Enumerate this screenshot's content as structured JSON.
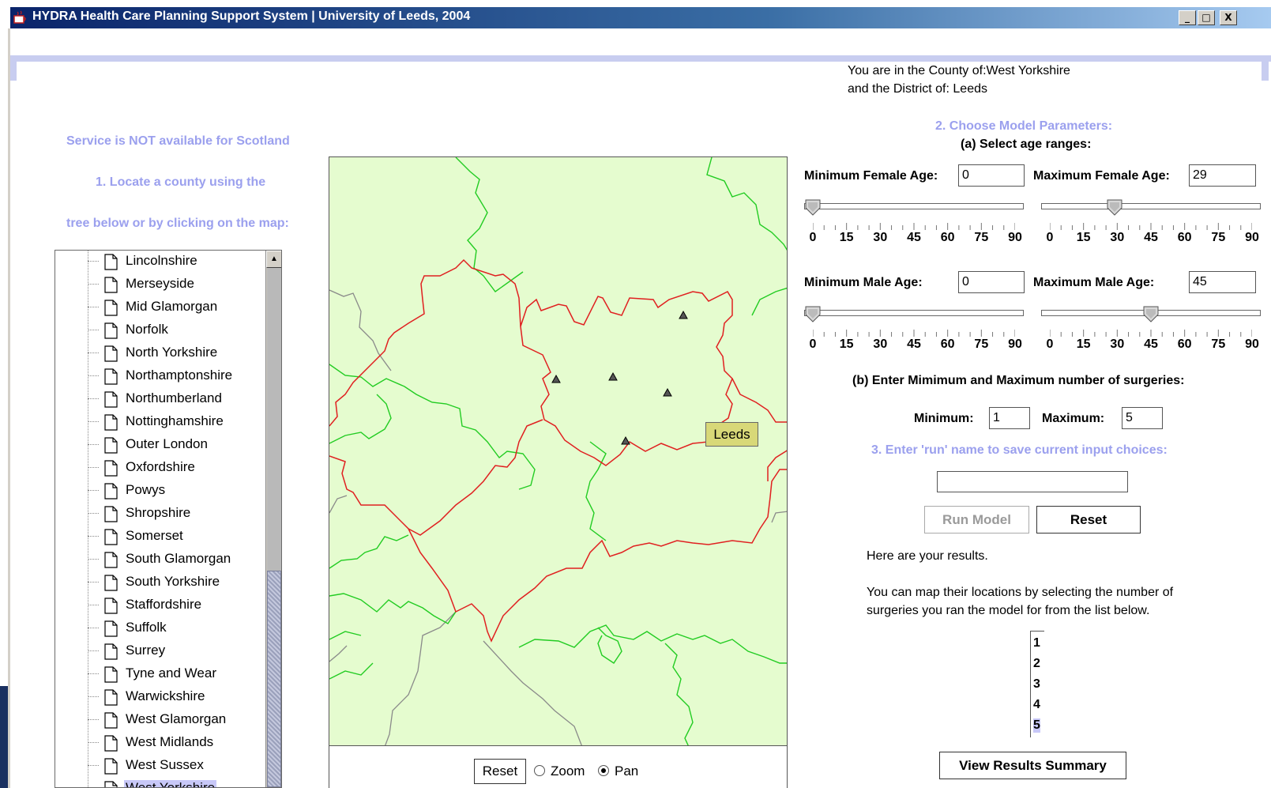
{
  "window": {
    "title": "HYDRA Health Care Planning Support System | University of Leeds, 2004",
    "controls": [
      "_",
      "□",
      "X"
    ]
  },
  "location": {
    "line1": "You are in the County of:West Yorkshire",
    "line2": "and the District of: Leeds"
  },
  "left_panel": {
    "notice": "Service is NOT available for Scotland",
    "step1_line1": "1. Locate a county using the",
    "step1_line2": "tree below or by clicking on the map:"
  },
  "tree": {
    "items": [
      {
        "label": "Lincolnshire"
      },
      {
        "label": "Merseyside"
      },
      {
        "label": "Mid Glamorgan"
      },
      {
        "label": "Norfolk"
      },
      {
        "label": "North Yorkshire"
      },
      {
        "label": "Northamptonshire"
      },
      {
        "label": "Northumberland"
      },
      {
        "label": "Nottinghamshire"
      },
      {
        "label": "Outer London"
      },
      {
        "label": "Oxfordshire"
      },
      {
        "label": "Powys"
      },
      {
        "label": "Shropshire"
      },
      {
        "label": "Somerset"
      },
      {
        "label": "South Glamorgan"
      },
      {
        "label": "South Yorkshire"
      },
      {
        "label": "Staffordshire"
      },
      {
        "label": "Suffolk"
      },
      {
        "label": "Surrey"
      },
      {
        "label": "Tyne and Wear"
      },
      {
        "label": "Warwickshire"
      },
      {
        "label": "West Glamorgan"
      },
      {
        "label": "West Midlands"
      },
      {
        "label": "West Sussex"
      },
      {
        "label": "West Yorkshire"
      }
    ],
    "selected": "West Yorkshire"
  },
  "map": {
    "tooltip": "Leeds",
    "reset_label": "Reset",
    "zoom_label": "Zoom",
    "pan_label": "Pan",
    "mode": "Pan"
  },
  "params": {
    "heading": "2. Choose Model Parameters:",
    "age_heading": "(a) Select age ranges:",
    "min_female_label": "Minimum Female Age:",
    "min_female_value": "0",
    "max_female_label": "Maximum Female Age:",
    "max_female_value": "29",
    "min_male_label": "Minimum Male Age:",
    "min_male_value": "0",
    "max_male_label": "Maximum Male Age:",
    "max_male_value": "45",
    "slider_labels": [
      "0",
      "15",
      "30",
      "45",
      "60",
      "75",
      "90"
    ],
    "slider_max": 90,
    "surgeries_heading": "(b) Enter Mimimum and Maximum number of surgeries:",
    "min_surg_label": "Minimum:",
    "min_surg_value": "1",
    "max_surg_label": "Maximum:",
    "max_surg_value": "5"
  },
  "run": {
    "heading": "3. Enter 'run' name to save current input choices:",
    "name_value": "",
    "run_label": "Run Model",
    "reset_label": "Reset"
  },
  "results": {
    "line1": "Here are your results.",
    "line2": "You can map their locations by selecting the number of",
    "line3": "surgeries you ran the model for from the list below.",
    "list": [
      "1",
      "2",
      "3",
      "4",
      "5"
    ],
    "selected": "5",
    "summary_label": "View Results Summary"
  },
  "colors": {
    "accent_text": "#9ba0ee",
    "map_land": "#e5fccf",
    "county_border": "#e02020",
    "district_border": "#20cc20",
    "selection": "#c8c8f8",
    "tooltip_bg": "#d8d878"
  }
}
